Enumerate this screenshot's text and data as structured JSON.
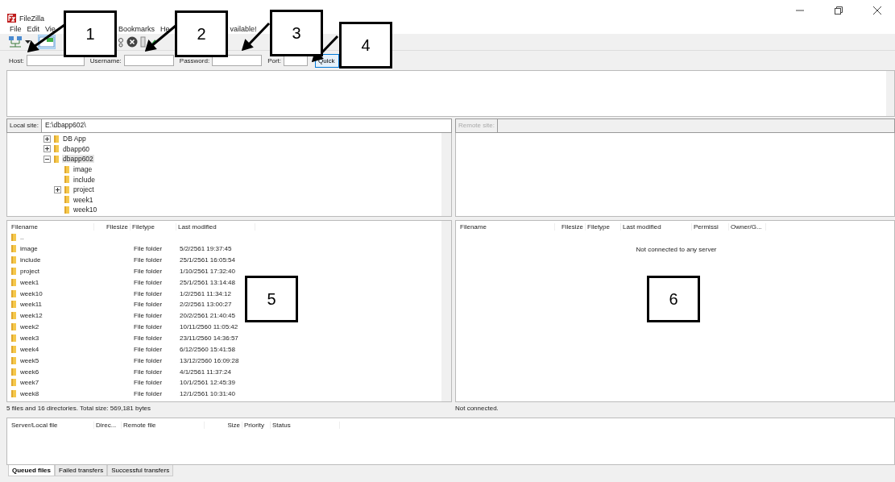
{
  "window": {
    "title": "FileZilla"
  },
  "menu": [
    "File",
    "Edit",
    "Vie",
    "Bookmarks",
    "He",
    "vailable!"
  ],
  "quickconnect": {
    "host_label": "Host:",
    "username_label": "Username:",
    "password_label": "Password:",
    "port_label": "Port:",
    "button": "Quick"
  },
  "local_site": {
    "label": "Local site:",
    "path": "E:\\dbapp602\\"
  },
  "tree": [
    {
      "name": "DB App",
      "kind": "collapsed",
      "selected": false
    },
    {
      "name": "dbapp60",
      "kind": "collapsed",
      "selected": false
    },
    {
      "name": "dbapp602",
      "kind": "expanded",
      "selected": true,
      "children": [
        {
          "name": "image",
          "kind": "leaf",
          "selected": false
        },
        {
          "name": "include",
          "kind": "leaf",
          "selected": false
        },
        {
          "name": "project",
          "kind": "collapsed",
          "selected": false
        },
        {
          "name": "week1",
          "kind": "leaf",
          "selected": false
        },
        {
          "name": "week10",
          "kind": "leaf",
          "selected": false
        }
      ]
    }
  ],
  "local_files": {
    "columns": [
      "Filename",
      "Filesize",
      "Filetype",
      "Last modified"
    ],
    "rows": [
      {
        "name": "..",
        "filetype": "",
        "modified": ""
      },
      {
        "name": "image",
        "filetype": "File folder",
        "modified": "5/2/2561 19:37:45"
      },
      {
        "name": "include",
        "filetype": "File folder",
        "modified": "25/1/2561 16:05:54"
      },
      {
        "name": "project",
        "filetype": "File folder",
        "modified": "1/10/2561 17:32:40"
      },
      {
        "name": "week1",
        "filetype": "File folder",
        "modified": "25/1/2561 13:14:48"
      },
      {
        "name": "week10",
        "filetype": "File folder",
        "modified": "1/2/2561 11:34:12"
      },
      {
        "name": "week11",
        "filetype": "File folder",
        "modified": "2/2/2561 13:00:27"
      },
      {
        "name": "week12",
        "filetype": "File folder",
        "modified": "20/2/2561 21:40:45"
      },
      {
        "name": "week2",
        "filetype": "File folder",
        "modified": "10/11/2560 11:05:42"
      },
      {
        "name": "week3",
        "filetype": "File folder",
        "modified": "23/11/2560 14:36:57"
      },
      {
        "name": "week4",
        "filetype": "File folder",
        "modified": "6/12/2560 15:41:58"
      },
      {
        "name": "week5",
        "filetype": "File folder",
        "modified": "13/12/2560 16:09:28"
      },
      {
        "name": "week6",
        "filetype": "File folder",
        "modified": "4/1/2561 11:37:24"
      },
      {
        "name": "week7",
        "filetype": "File folder",
        "modified": "10/1/2561 12:45:39"
      },
      {
        "name": "week8",
        "filetype": "File folder",
        "modified": "12/1/2561 10:31:40"
      }
    ],
    "status": "5 files and 16 directories. Total size: 569,181 bytes"
  },
  "remote_site": {
    "label": "Remote site:"
  },
  "remote_files": {
    "columns": [
      "Filename",
      "Filesize",
      "Filetype",
      "Last modified",
      "Permissi",
      "Owner/G..."
    ],
    "message": "Not connected to any server",
    "status": "Not connected."
  },
  "queue": {
    "columns": [
      "Server/Local file",
      "Direc...",
      "Remote file",
      "Size",
      "Priority",
      "Status"
    ],
    "tabs": [
      {
        "label": "Queued files",
        "selected": true
      },
      {
        "label": "Failed transfers",
        "selected": false
      },
      {
        "label": "Successful transfers",
        "selected": false
      }
    ]
  },
  "callouts": [
    "1",
    "2",
    "3",
    "4",
    "5",
    "6"
  ]
}
